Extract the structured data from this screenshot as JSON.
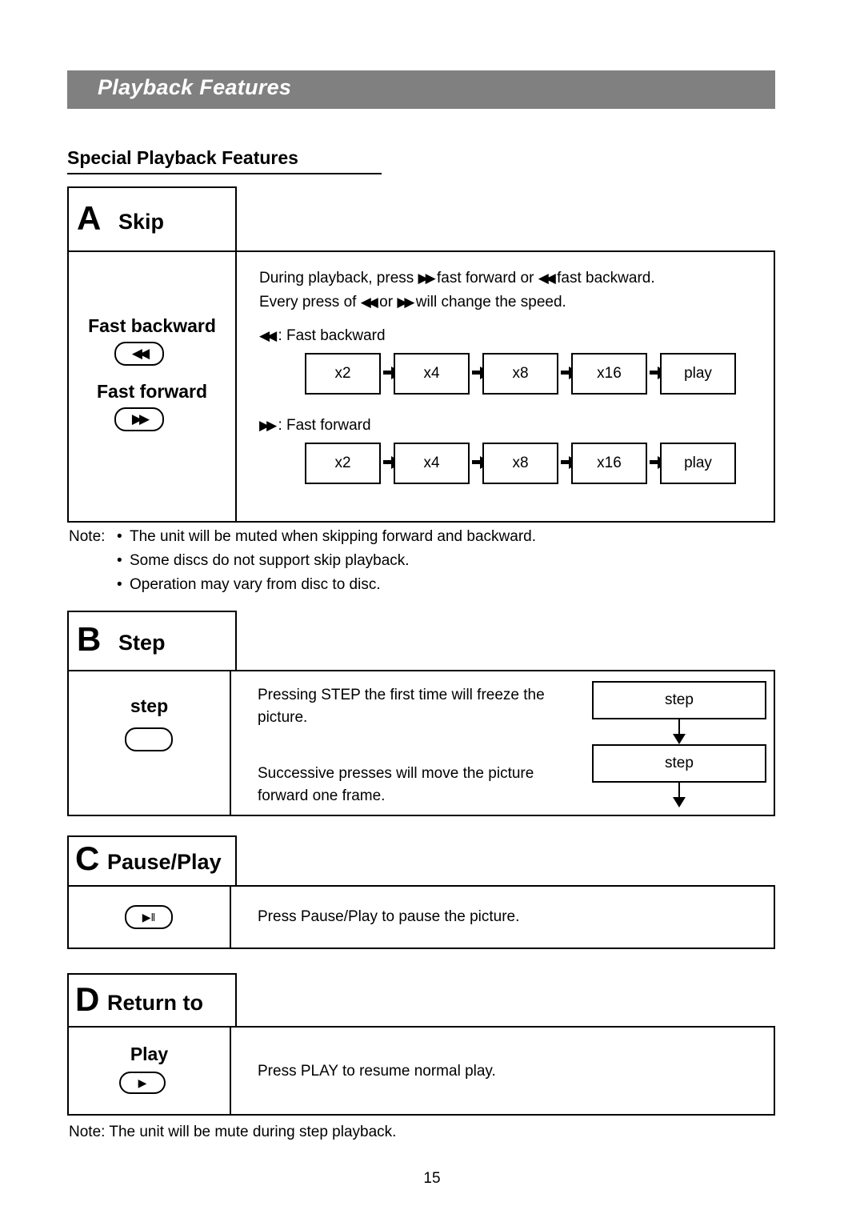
{
  "header": {
    "title": "Playback Features"
  },
  "section": {
    "title": "Special Playback Features"
  },
  "blocks": {
    "a": {
      "letter": "A",
      "title": "Skip",
      "left": {
        "fast_backward_label": "Fast backward",
        "fast_backward_icon": "rewind-icon",
        "fast_forward_label": "Fast forward",
        "fast_forward_icon": "fast-forward-icon"
      },
      "right": {
        "line1_part1": "During playback, press",
        "line1_part2": "fast forward or",
        "line1_part3": "fast backward.",
        "line2_part1": "Every press of",
        "line2_part2": "or",
        "line2_part3": "will change the speed.",
        "fb_caption": ": Fast backward",
        "ff_caption": ": Fast forward",
        "fb_steps": [
          "x2",
          "x4",
          "x8",
          "x16",
          "play"
        ],
        "ff_steps": [
          "x2",
          "x4",
          "x8",
          "x16",
          "play"
        ]
      }
    },
    "a_notes": {
      "label": "Note:",
      "items": [
        "The unit will be muted when skipping forward and backward.",
        "Some discs do not support skip playback.",
        "Operation may vary from disc to disc."
      ]
    },
    "b": {
      "letter": "B",
      "title": "Step",
      "left": {
        "label": "step",
        "icon": "step-button-icon"
      },
      "right": {
        "text1_line1": "Pressing STEP the first time will freeze the",
        "text1_line2": "picture.",
        "text2_line1": "Successive presses will move the picture",
        "text2_line2": "forward one frame.",
        "flow": [
          "step",
          "step"
        ]
      }
    },
    "c": {
      "letter": "C",
      "title": "Pause/Play",
      "left": {
        "icon": "play-pause-button-icon"
      },
      "right": {
        "text": "Press Pause/Play to pause the picture."
      }
    },
    "d": {
      "letter": "D",
      "title": "Return to",
      "left": {
        "label": "Play",
        "icon": "play-button-icon"
      },
      "right": {
        "text": "Press PLAY to resume normal play."
      }
    },
    "d_note": {
      "text": "Note: The unit will be mute during step playback."
    }
  },
  "footer": {
    "page_number": "15"
  }
}
